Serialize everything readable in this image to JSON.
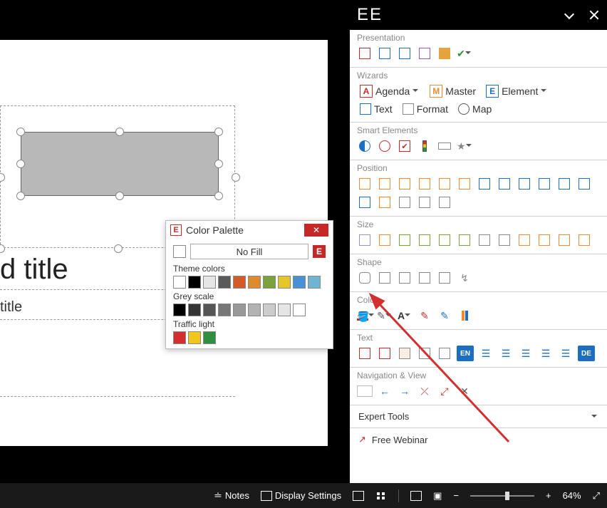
{
  "statusbar": {
    "notes": "Notes",
    "display_settings": "Display Settings",
    "zoom": "64%"
  },
  "panel": {
    "header_title": "EE",
    "sections": {
      "presentation": "Presentation",
      "wizards": "Wizards",
      "smart_elements": "Smart Elements",
      "position": "Position",
      "size": "Size",
      "shape": "Shape",
      "color": "Color",
      "text": "Text",
      "navigation": "Navigation & View"
    },
    "wizards_buttons": {
      "agenda": "Agenda",
      "agenda_letter": "A",
      "master": "Master",
      "master_letter": "M",
      "element": "Element",
      "element_letter": "E",
      "text": "Text",
      "format": "Format",
      "map": "Map"
    },
    "color_font_letter": "A",
    "text_lang1": "EN",
    "text_lang2": "DE",
    "expert_tools": "Expert Tools",
    "free_webinar": "Free Webinar"
  },
  "slide": {
    "title1": "d title",
    "subtitle": "title"
  },
  "color_popup": {
    "title": "Color Palette",
    "logo_letter": "E",
    "nofill": "No Fill",
    "theme_label": "Theme colors",
    "theme_colors": [
      "#ffffff",
      "#000000",
      "#e6e6e6",
      "#5a5a5a",
      "#d35a2b",
      "#e08a2e",
      "#7aa33d",
      "#e6c72b",
      "#4792d6",
      "#6fb5d1"
    ],
    "grey_label": "Grey scale",
    "grey_colors": [
      "#000000",
      "#333333",
      "#555555",
      "#777777",
      "#999999",
      "#b3b3b3",
      "#cccccc",
      "#e5e5e5",
      "#ffffff"
    ],
    "traffic_label": "Traffic light",
    "traffic_colors": [
      "#d32f2f",
      "#f2c71b",
      "#2e8f3e"
    ]
  }
}
